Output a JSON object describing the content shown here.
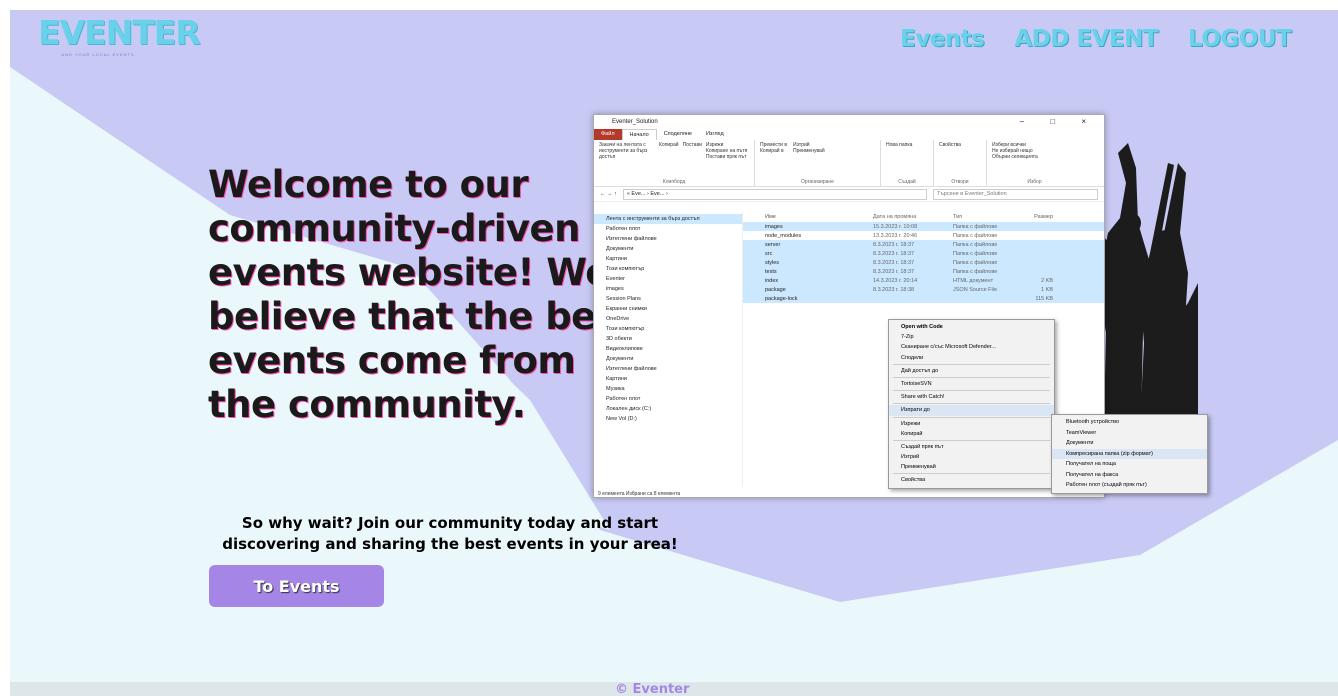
{
  "brand": {
    "logo": "EVENTER",
    "tagline": "AND YOUR LOCAL EVENTS"
  },
  "nav": [
    {
      "label": "Events"
    },
    {
      "label": "ADD EVENT"
    },
    {
      "label": "LOGOUT"
    }
  ],
  "hero": {
    "headline": "Welcome to our community-driven events website! We believe that the best events come from the community.",
    "subtext": "So why wait? Join our community today and start discovering and sharing the best events in your area!",
    "button_label": "To Events"
  },
  "footer": {
    "text": "© Eventer"
  },
  "colors": {
    "accent": "#69d2ea",
    "purple": "#a586e6",
    "lavender": "#c8c9f5",
    "light": "#eaf7fb"
  },
  "screenshot": {
    "title": "Eventer_Solution",
    "tabs": [
      "Файл",
      "Начало",
      "Споделяне",
      "Изглед"
    ],
    "ribbon_groups": [
      "Клипборд",
      "Организиране",
      "Създай",
      "Отвори",
      "Избор"
    ],
    "ribbon": {
      "clipboard": [
        "Закачи на лентата с инструменти за бърз достъп",
        "Копирай",
        "Постави",
        "Изрежи",
        "Копиране на пътя",
        "Постави пряк път"
      ],
      "organize": [
        "Премести в",
        "Изтрий",
        "Копирай в",
        "Преименувай"
      ],
      "create": [
        "Нова папка"
      ],
      "open": [
        "Свойства"
      ],
      "select": [
        "Избери всички",
        "Не избирай нищо",
        "Обърни селекцията"
      ]
    },
    "address": "« Eve... › Eve... ›",
    "search_placeholder": "Търсене в Eventer_Solution",
    "sidebar": [
      "Лента с инструменти за бърз достъп",
      "Работен плот",
      "Изтеглени файлове",
      "Документи",
      "Картини",
      "Този компютър",
      "Eventer",
      "images",
      "Session Plans",
      "Екранни снимки",
      "OneDrive",
      "Този компютър",
      "3D обекти",
      "Видеоклипове",
      "Документи",
      "Изтеглени файлове",
      "Картини",
      "Музика",
      "Работен плот",
      "Локален диск (C:)",
      "New Vol (D:)"
    ],
    "columns": [
      "Име",
      "Дата на промяна",
      "Тип",
      "Размер"
    ],
    "files": [
      {
        "name": "images",
        "date": "15.3.2023 г. 10:08",
        "type": "Папка с файлове",
        "size": ""
      },
      {
        "name": "node_modules",
        "date": "13.3.2023 г. 20:46",
        "type": "Папка с файлове",
        "size": ""
      },
      {
        "name": "server",
        "date": "8.3.2023 г. 18:37",
        "type": "Папка с файлове",
        "size": ""
      },
      {
        "name": "src",
        "date": "8.3.2023 г. 18:37",
        "type": "Папка с файлове",
        "size": ""
      },
      {
        "name": "styles",
        "date": "8.3.2023 г. 18:37",
        "type": "Папка с файлове",
        "size": ""
      },
      {
        "name": "tests",
        "date": "8.3.2023 г. 18:37",
        "type": "Папка с файлове",
        "size": ""
      },
      {
        "name": "index",
        "date": "14.3.2023 г. 20:14",
        "type": "HTML документ",
        "size": "2 KB"
      },
      {
        "name": "package",
        "date": "8.3.2023 г. 18:38",
        "type": "JSON Source File",
        "size": "1 KB"
      },
      {
        "name": "package-lock",
        "date": "",
        "type": "",
        "size": "115 KB"
      }
    ],
    "status": "9 елемента   Избрани са 8 елемента",
    "context_menu": [
      "Open with Code",
      "7-Zip",
      "Сканиране с/със Microsoft Defender...",
      "Сподели",
      "Дай достъп до",
      "TortoiseSVN",
      "Share with Catch!",
      "Изпрати до",
      "Изрежи",
      "Копирай",
      "Създай пряк път",
      "Изтрий",
      "Преименувай",
      "Свойства"
    ],
    "send_to": [
      "Bluetooth устройство",
      "TeamViewer",
      "Документи",
      "Компресирана папка (zip формат)",
      "Получател на поща",
      "Получател на факса",
      "Работен плот (създай пряк път)"
    ]
  }
}
